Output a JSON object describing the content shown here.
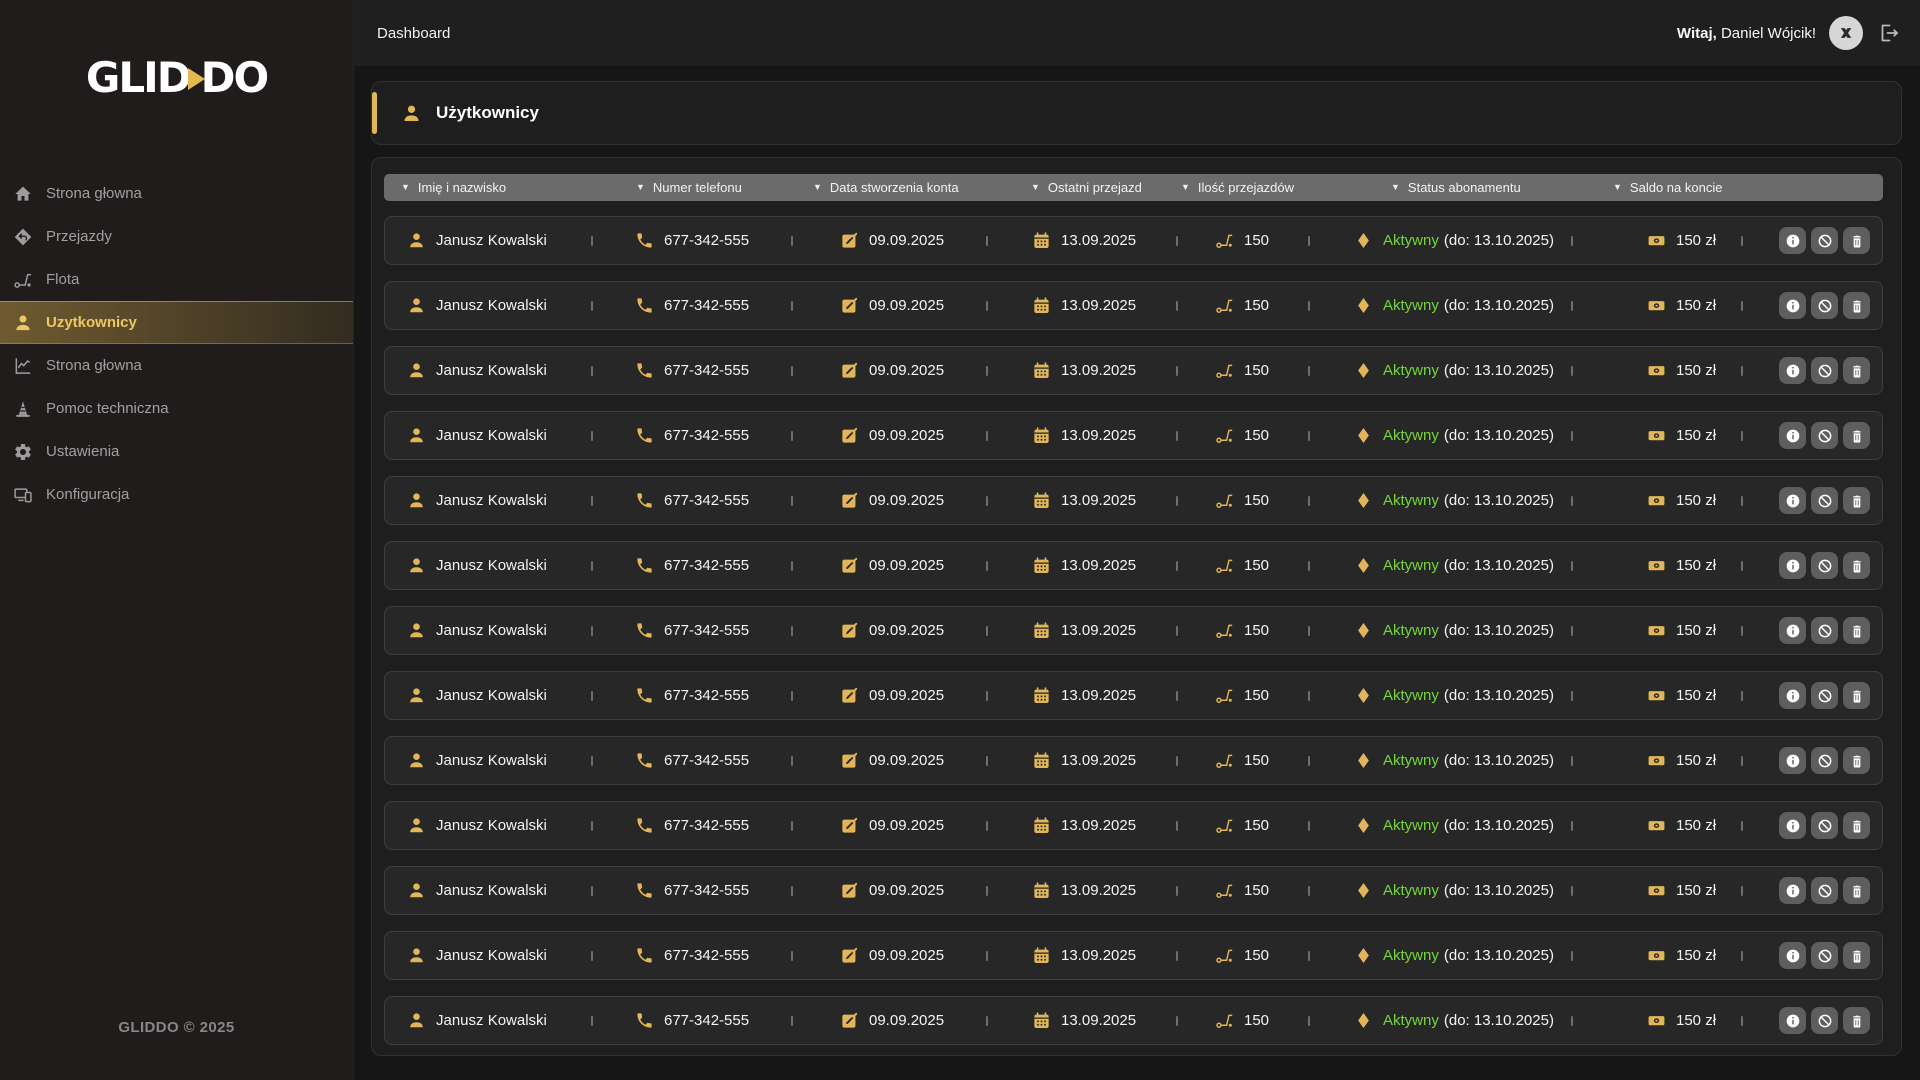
{
  "app": {
    "logo_left": "GLID",
    "logo_right": "DO",
    "footer": "GLIDDO © 2025"
  },
  "topbar": {
    "title": "Dashboard",
    "greeting_prefix": "Witaj,",
    "greeting_name": " Daniel Wójcik!",
    "avatar_icon": "brand-x-logo",
    "logout_icon": "logout-arrow"
  },
  "sidebar": {
    "items": [
      {
        "label": "Strona głowna",
        "icon": "home-icon",
        "active": false
      },
      {
        "label": "Przejazdy",
        "icon": "directions-diamond-icon",
        "active": false
      },
      {
        "label": "Flota",
        "icon": "scooter-icon",
        "active": false
      },
      {
        "label": "Uzytkownicy",
        "icon": "user-icon",
        "active": true
      },
      {
        "label": "Strona głowna",
        "icon": "line-chart-icon",
        "active": false
      },
      {
        "label": "Pomoc techniczna",
        "icon": "traffic-cone-icon",
        "active": false
      },
      {
        "label": "Ustawienia",
        "icon": "gear-icon",
        "active": false
      },
      {
        "label": "Konfiguracja",
        "icon": "devices-icon",
        "active": false
      }
    ]
  },
  "panel": {
    "title": "Użytkownicy",
    "title_icon": "user-icon"
  },
  "table": {
    "filter_icon": "▼",
    "columns": [
      "Imię i nazwisko",
      "Numer telefonu",
      "Data stworzenia konta",
      "Ostatni przejazd",
      "Ilość przejazdów",
      "Status abonamentu",
      "Saldo na koncie"
    ],
    "row_icons": {
      "name": "user-icon",
      "phone": "phone-icon",
      "created": "edit-note-icon",
      "last_ride": "calendar-icon",
      "rides": "scooter-icon",
      "status": "diamond-icon",
      "balance": "banknote-icon"
    },
    "action_icons": [
      "info-icon",
      "ban-icon",
      "trash-icon"
    ],
    "rows": [
      {
        "name": "Janusz Kowalski",
        "phone": "677-342-555",
        "created": "09.09.2025",
        "last_ride": "13.09.2025",
        "rides": "150",
        "status": "Aktywny",
        "status_until": "(do: 13.10.2025)",
        "balance": "150 zł"
      },
      {
        "name": "Janusz Kowalski",
        "phone": "677-342-555",
        "created": "09.09.2025",
        "last_ride": "13.09.2025",
        "rides": "150",
        "status": "Aktywny",
        "status_until": "(do: 13.10.2025)",
        "balance": "150 zł"
      },
      {
        "name": "Janusz Kowalski",
        "phone": "677-342-555",
        "created": "09.09.2025",
        "last_ride": "13.09.2025",
        "rides": "150",
        "status": "Aktywny",
        "status_until": "(do: 13.10.2025)",
        "balance": "150 zł"
      },
      {
        "name": "Janusz Kowalski",
        "phone": "677-342-555",
        "created": "09.09.2025",
        "last_ride": "13.09.2025",
        "rides": "150",
        "status": "Aktywny",
        "status_until": "(do: 13.10.2025)",
        "balance": "150 zł"
      },
      {
        "name": "Janusz Kowalski",
        "phone": "677-342-555",
        "created": "09.09.2025",
        "last_ride": "13.09.2025",
        "rides": "150",
        "status": "Aktywny",
        "status_until": "(do: 13.10.2025)",
        "balance": "150 zł"
      },
      {
        "name": "Janusz Kowalski",
        "phone": "677-342-555",
        "created": "09.09.2025",
        "last_ride": "13.09.2025",
        "rides": "150",
        "status": "Aktywny",
        "status_until": "(do: 13.10.2025)",
        "balance": "150 zł"
      },
      {
        "name": "Janusz Kowalski",
        "phone": "677-342-555",
        "created": "09.09.2025",
        "last_ride": "13.09.2025",
        "rides": "150",
        "status": "Aktywny",
        "status_until": "(do: 13.10.2025)",
        "balance": "150 zł"
      },
      {
        "name": "Janusz Kowalski",
        "phone": "677-342-555",
        "created": "09.09.2025",
        "last_ride": "13.09.2025",
        "rides": "150",
        "status": "Aktywny",
        "status_until": "(do: 13.10.2025)",
        "balance": "150 zł"
      },
      {
        "name": "Janusz Kowalski",
        "phone": "677-342-555",
        "created": "09.09.2025",
        "last_ride": "13.09.2025",
        "rides": "150",
        "status": "Aktywny",
        "status_until": "(do: 13.10.2025)",
        "balance": "150 zł"
      },
      {
        "name": "Janusz Kowalski",
        "phone": "677-342-555",
        "created": "09.09.2025",
        "last_ride": "13.09.2025",
        "rides": "150",
        "status": "Aktywny",
        "status_until": "(do: 13.10.2025)",
        "balance": "150 zł"
      },
      {
        "name": "Janusz Kowalski",
        "phone": "677-342-555",
        "created": "09.09.2025",
        "last_ride": "13.09.2025",
        "rides": "150",
        "status": "Aktywny",
        "status_until": "(do: 13.10.2025)",
        "balance": "150 zł"
      },
      {
        "name": "Janusz Kowalski",
        "phone": "677-342-555",
        "created": "09.09.2025",
        "last_ride": "13.09.2025",
        "rides": "150",
        "status": "Aktywny",
        "status_until": "(do: 13.10.2025)",
        "balance": "150 zł"
      },
      {
        "name": "Janusz Kowalski",
        "phone": "677-342-555",
        "created": "09.09.2025",
        "last_ride": "13.09.2025",
        "rides": "150",
        "status": "Aktywny",
        "status_until": "(do: 13.10.2025)",
        "balance": "150 zł"
      }
    ]
  },
  "colors": {
    "accent_gold": "#e2b658",
    "status_green": "#74d63c",
    "header_bar": "#6b6b6b",
    "background": "#161616",
    "card": "#1e1e1e",
    "row": "#272727",
    "sidebar": "#1f1c1b"
  }
}
